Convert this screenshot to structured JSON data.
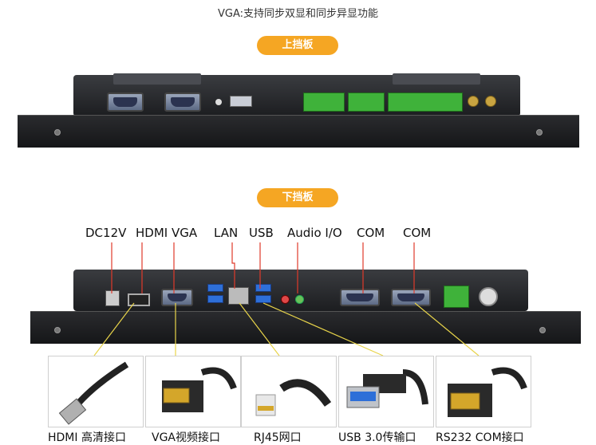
{
  "header": {
    "title": "VGA:支持同步双显和同步异显功能"
  },
  "top_panel": {
    "pill_label": "上挡板"
  },
  "bottom_panel": {
    "pill_label": "下挡板",
    "port_labels": [
      "DC12V",
      "HDMI VGA",
      "LAN",
      "USB",
      "Audio I/O",
      "COM",
      "COM"
    ]
  },
  "cables": [
    {
      "caption": "HDMI 高清接口",
      "icon": "hdmi-cable-icon"
    },
    {
      "caption": "VGA视频接口",
      "icon": "vga-cable-icon"
    },
    {
      "caption": "RJ45网口",
      "icon": "rj45-cable-icon"
    },
    {
      "caption": "USB 3.0传输口",
      "icon": "usb-cable-icon"
    },
    {
      "caption": "RS232 COM接口",
      "icon": "rs232-cable-icon"
    }
  ],
  "colors": {
    "accent": "#f5a623",
    "leader_red": "#e03a2a",
    "leader_yellow": "#e8d44a",
    "terminal_green": "#3fb23a"
  }
}
